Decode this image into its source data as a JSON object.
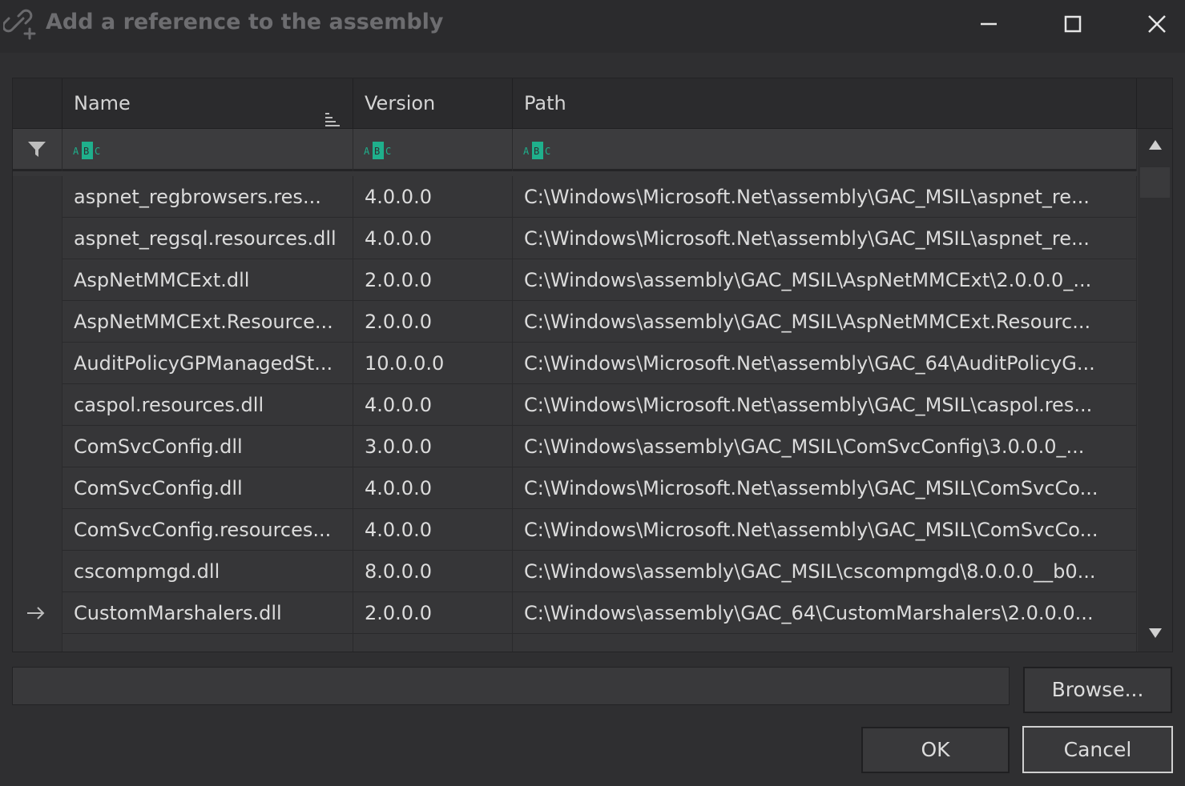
{
  "window": {
    "title": "Add a reference to the assembly",
    "icons": {
      "title": "link-add-icon",
      "minimize": "minimize-icon",
      "maximize": "maximize-icon",
      "close": "close-icon"
    }
  },
  "grid": {
    "columns": [
      {
        "key": "name",
        "label": "Name",
        "sorted": "ascending"
      },
      {
        "key": "version",
        "label": "Version"
      },
      {
        "key": "path",
        "label": "Path"
      }
    ],
    "filter_icon": "funnel-icon",
    "filter_cell_icon": "abc-text-filter-icon",
    "rows": [
      {
        "name": "aspnet_regbrowsers.res...",
        "version": "4.0.0.0",
        "path": "C:\\Windows\\Microsoft.Net\\assembly\\GAC_MSIL\\aspnet_re..."
      },
      {
        "name": "aspnet_regsql.resources.dll",
        "version": "4.0.0.0",
        "path": "C:\\Windows\\Microsoft.Net\\assembly\\GAC_MSIL\\aspnet_re..."
      },
      {
        "name": "AspNetMMCExt.dll",
        "version": "2.0.0.0",
        "path": "C:\\Windows\\assembly\\GAC_MSIL\\AspNetMMCExt\\2.0.0.0_..."
      },
      {
        "name": "AspNetMMCExt.Resource...",
        "version": "2.0.0.0",
        "path": "C:\\Windows\\assembly\\GAC_MSIL\\AspNetMMCExt.Resourc..."
      },
      {
        "name": "AuditPolicyGPManagedSt...",
        "version": "10.0.0.0",
        "path": "C:\\Windows\\Microsoft.Net\\assembly\\GAC_64\\AuditPolicyG..."
      },
      {
        "name": "caspol.resources.dll",
        "version": "4.0.0.0",
        "path": "C:\\Windows\\Microsoft.Net\\assembly\\GAC_MSIL\\caspol.res..."
      },
      {
        "name": "ComSvcConfig.dll",
        "version": "3.0.0.0",
        "path": "C:\\Windows\\assembly\\GAC_MSIL\\ComSvcConfig\\3.0.0.0_..."
      },
      {
        "name": "ComSvcConfig.dll",
        "version": "4.0.0.0",
        "path": "C:\\Windows\\Microsoft.Net\\assembly\\GAC_MSIL\\ComSvcCo..."
      },
      {
        "name": "ComSvcConfig.resources...",
        "version": "4.0.0.0",
        "path": "C:\\Windows\\Microsoft.Net\\assembly\\GAC_MSIL\\ComSvcCo..."
      },
      {
        "name": "cscompmgd.dll",
        "version": "8.0.0.0",
        "path": "C:\\Windows\\assembly\\GAC_MSIL\\cscompmgd\\8.0.0.0__b0..."
      },
      {
        "name": "CustomMarshalers.dll",
        "version": "2.0.0.0",
        "path": "C:\\Windows\\assembly\\GAC_64\\CustomMarshalers\\2.0.0.0...",
        "current": true
      }
    ]
  },
  "path_input": {
    "value": "",
    "placeholder": ""
  },
  "buttons": {
    "browse": "Browse...",
    "ok": "OK",
    "cancel": "Cancel"
  },
  "colors": {
    "accent": "#1fb08c",
    "background": "#2f2f31",
    "title_text": "#6d6d70"
  }
}
